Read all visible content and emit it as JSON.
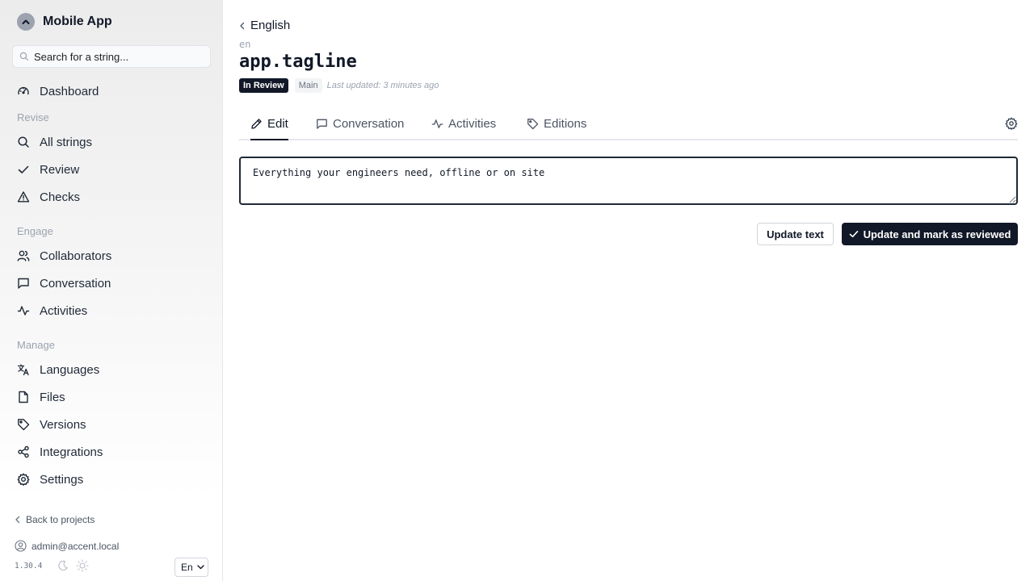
{
  "app": {
    "title": "Mobile App"
  },
  "search": {
    "placeholder": "Search for a string..."
  },
  "sidebar": {
    "dashboard": "Dashboard",
    "sections": {
      "revise": "Revise",
      "engage": "Engage",
      "manage": "Manage"
    },
    "revise_items": [
      "All strings",
      "Review",
      "Checks"
    ],
    "engage_items": [
      "Collaborators",
      "Conversation",
      "Activities"
    ],
    "manage_items": [
      "Languages",
      "Files",
      "Versions",
      "Integrations",
      "Settings"
    ],
    "back_label": "Back to projects",
    "user_email": "admin@accent.local",
    "version": "1.30.4",
    "language_selector": "En"
  },
  "header": {
    "breadcrumb": "English",
    "language_code": "en",
    "key": "app.tagline",
    "status_badge": "In Review",
    "branch_badge": "Main",
    "last_updated": "Last updated: 3 minutes ago"
  },
  "tabs": [
    "Edit",
    "Conversation",
    "Activities",
    "Editions"
  ],
  "active_tab": "Edit",
  "editor": {
    "value": "Everything your engineers need, offline or on site"
  },
  "actions": {
    "update_label": "Update text",
    "review_label": "Update and mark as reviewed"
  },
  "colors": {
    "primary": "#111827",
    "muted": "#9ca3af",
    "sidebar_bg": "#efefef"
  },
  "icons": {
    "brand": "chevron-up-icon",
    "dashboard": "gauge-icon",
    "all_strings": "search-icon",
    "review": "check-icon",
    "checks": "warning-triangle-icon",
    "collaborators": "users-icon",
    "conversation": "message-square-icon",
    "activities": "activity-icon",
    "languages": "translate-icon",
    "files": "file-icon",
    "versions": "tag-icon",
    "integrations": "share-icon",
    "settings": "gear-icon"
  }
}
